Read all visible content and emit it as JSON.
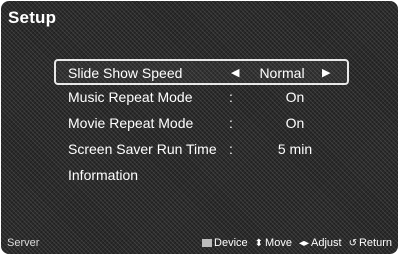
{
  "title": "Setup",
  "menu": [
    {
      "label": "Slide Show Speed",
      "value": "Normal",
      "selected": true
    },
    {
      "label": "Music Repeat Mode",
      "value": "On"
    },
    {
      "label": "Movie Repeat Mode",
      "value": "On"
    },
    {
      "label": "Screen Saver Run Time",
      "value": "5 min"
    },
    {
      "label": "Information",
      "value": ""
    }
  ],
  "separator": ":",
  "arrows": {
    "left": "◀",
    "right": "▶"
  },
  "footer": {
    "left": "Server",
    "hints": [
      {
        "icon": "device-button-icon",
        "label": "Device"
      },
      {
        "icon": "updown-arrows-icon",
        "glyph": "⬍",
        "label": "Move"
      },
      {
        "icon": "leftright-arrows-icon",
        "glyph": "◂▸",
        "label": "Adjust"
      },
      {
        "icon": "return-icon",
        "glyph": "↺",
        "label": "Return"
      }
    ]
  }
}
